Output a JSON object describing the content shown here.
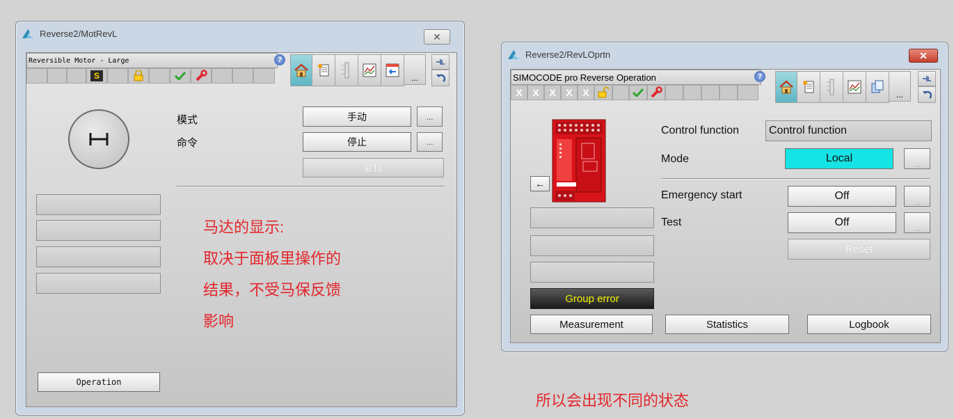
{
  "left_window": {
    "title": "Reverse2/MotRevL",
    "header_text": "Reversible Motor - Large",
    "status_s": "S",
    "mode_label": "模式",
    "mode_value": "手动",
    "command_label": "命令",
    "command_value": "停止",
    "reset_label": "复位",
    "operation_label": "Operation",
    "more_label": "...",
    "toolbar_more": "...",
    "close_glyph": "✕"
  },
  "right_window": {
    "title": "Reverse2/RevLOprtn",
    "header_text": "SIMOCODE pro Reverse Operation",
    "x_cells": [
      "X",
      "X",
      "X",
      "X",
      "X"
    ],
    "control_function_label": "Control function",
    "control_function_value": "Control function",
    "mode_label": "Mode",
    "mode_value": "Local",
    "emergency_start_label": "Emergency start",
    "emergency_start_value": "Off",
    "test_label": "Test",
    "test_value": "Off",
    "reset_label": "Reset",
    "group_error_label": "Group error",
    "measurement_label": "Measurement",
    "statistics_label": "Statistics",
    "logbook_label": "Logbook",
    "more_label": "...",
    "toolbar_more": "...",
    "arrow_glyph": "←",
    "close_glyph": "✕"
  },
  "annotations": {
    "left_note_lines": [
      "马达的显示:",
      "取决于面板里操作的",
      "结果，不受马保反馈",
      "影响"
    ],
    "bottom_note": "所以会出现不同的状态"
  },
  "colors": {
    "mode_local": "#16e3e3",
    "annotation_red": "#e3262c",
    "group_error_text": "#f4f300"
  }
}
